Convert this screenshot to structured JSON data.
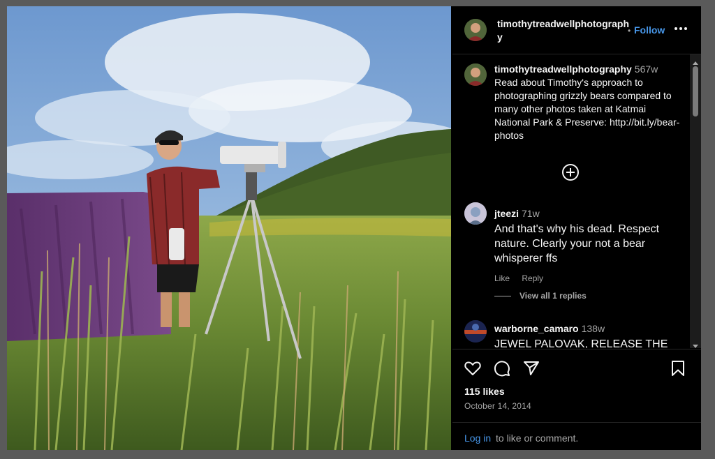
{
  "header": {
    "username": "timothytreadwellphotography",
    "separator": "•",
    "follow_label": "Follow",
    "more_icon": "more-horizontal-icon"
  },
  "caption": {
    "username": "timothytreadwellphotography",
    "time": "567w",
    "text": "Read about Timothy's approach to photographing grizzly bears compared to many other photos taken at Katmai National Park & Preserve: http://bit.ly/bear-photos"
  },
  "load_more_icon": "plus-circle-icon",
  "comments": [
    {
      "username": "jteezi",
      "time": "71w",
      "text": "And that's why his dead. Respect nature. Clearly your not a bear whisperer ffs",
      "like_label": "Like",
      "reply_label": "Reply",
      "view_replies_label": "View all 1 replies"
    },
    {
      "username": "warborne_camaro",
      "time": "138w",
      "text": "JEWEL PALOVAK, RELEASE THE AUDIO FOR US TO LISTEN"
    }
  ],
  "actions": {
    "icons": [
      "heart-icon",
      "comment-icon",
      "share-icon",
      "bookmark-icon"
    ],
    "likes": "115 likes",
    "date": "October 14, 2014"
  },
  "login": {
    "link": "Log in",
    "rest": "to like or comment."
  },
  "colors": {
    "link_blue": "#4796e8",
    "muted": "#a8a8a8",
    "background": "#000000"
  }
}
